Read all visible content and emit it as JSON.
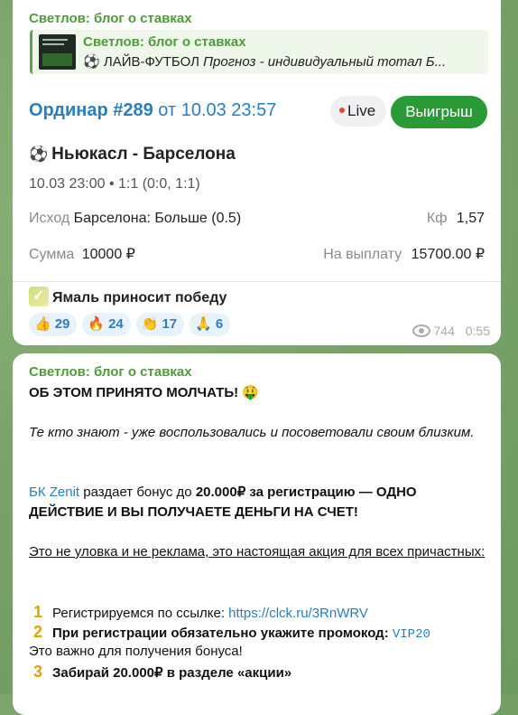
{
  "post1": {
    "channel": "Светлов: блог о ставках",
    "reply": {
      "name": "Светлов: блог о ставках",
      "icon": "⚽",
      "prefix": "ЛАЙВ-ФУТБОЛ",
      "text": "Прогноз - индивидуальный тотал Б..."
    },
    "order_label": "Ординар #289",
    "order_date": "от 10.03 23:57",
    "live_label": "Live",
    "win_label": "Выигрыш",
    "match_icon": "⚽",
    "match": "Ньюкасл - Барселона",
    "meta": "10.03 23:00 • 1:1 (0:0, 1:1)",
    "outcome_label": "Исход",
    "outcome_value": "Барселона: Больше (0.5)",
    "coef_label": "Кф",
    "coef_value": "1,57",
    "sum_label": "Сумма",
    "sum_value": "10000 ₽",
    "payout_label": "На выплату",
    "payout_value": "15700.00 ₽",
    "footer_text": "Ямаль приносит победу",
    "reactions": [
      {
        "emoji": "👍",
        "count": "29"
      },
      {
        "emoji": "🔥",
        "count": "24"
      },
      {
        "emoji": "👏",
        "count": "17"
      },
      {
        "emoji": "🙏",
        "count": "6"
      }
    ],
    "views": "744",
    "time": "0:55"
  },
  "post2": {
    "channel": "Светлов: блог о ставках",
    "headline": "ОБ ЭТОМ ПРИНЯТО МОЛЧАТЬ!",
    "headline_emoji": "🤑",
    "italic": "Те кто знают - уже воспользовались и посоветовали своим близким.",
    "p3_link": "БК Zenit",
    "p3_mid": "раздает бонус до",
    "p3_bold": "20.000₽ за регистрацию — ОДНО ДЕЙСТВИЕ И ВЫ ПОЛУЧАЕТЕ ДЕНЬГИ НА СЧЕТ!",
    "underlined": "Это не уловка и не реклама, это настоящая акция для всех причастных:",
    "step1_num": "1",
    "step1_text": "Регистрируемся по ссылке:",
    "step1_link": "https://clck.ru/3RnWRV",
    "step2_num": "2",
    "step2_text": "При регистрации обязательно укажите промокод:",
    "step2_code": "VIP20",
    "step2_note": "Это важно для получения бонуса!",
    "step3_num": "3",
    "step3_text": "Забирай 20.000₽ в разделе «акции»"
  }
}
